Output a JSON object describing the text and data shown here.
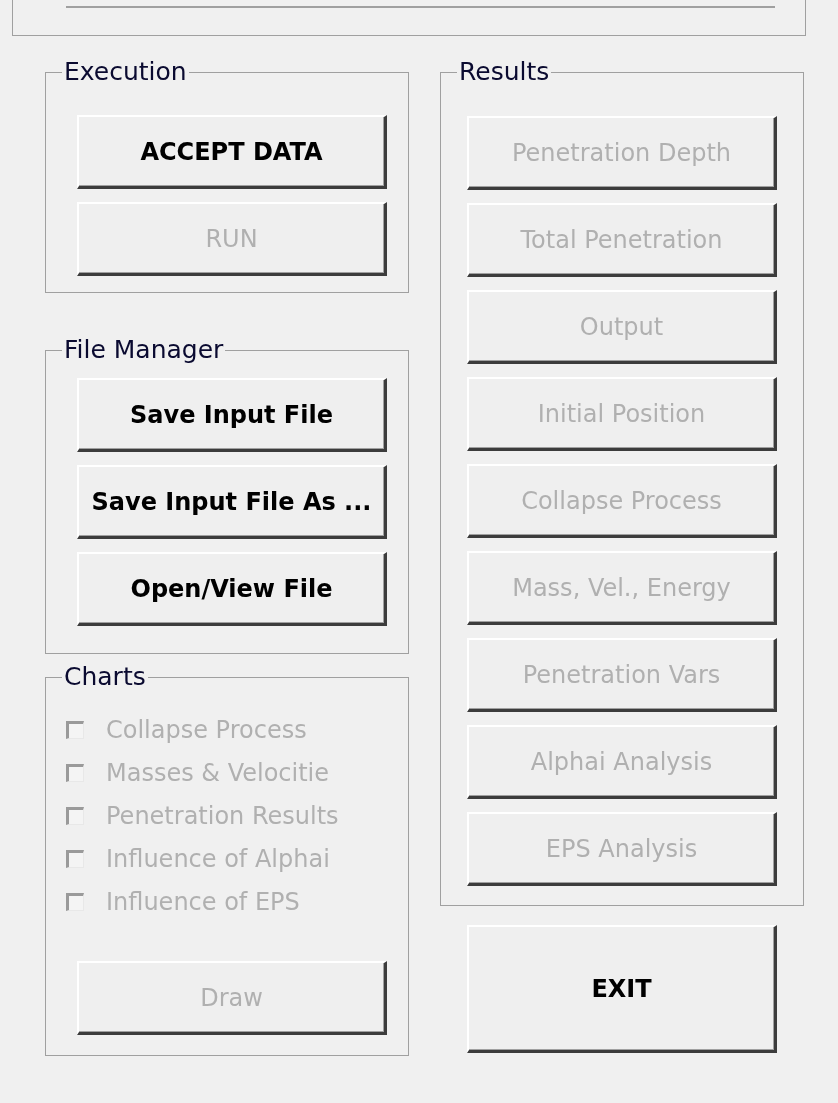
{
  "execution": {
    "title": "Execution",
    "buttons": [
      {
        "label": "ACCEPT DATA",
        "disabled": false
      },
      {
        "label": "RUN",
        "disabled": true
      }
    ]
  },
  "file_manager": {
    "title": "File Manager",
    "buttons": [
      {
        "label": "Save Input File",
        "disabled": false
      },
      {
        "label": "Save Input File As ...",
        "disabled": false
      },
      {
        "label": "Open/View File",
        "disabled": false
      }
    ]
  },
  "charts": {
    "title": "Charts",
    "checkboxes": [
      {
        "label": "Collapse Process",
        "checked": false,
        "disabled": true
      },
      {
        "label": "Masses & Velocitie",
        "checked": false,
        "disabled": true
      },
      {
        "label": "Penetration Results",
        "checked": false,
        "disabled": true
      },
      {
        "label": "Influence of Alphai",
        "checked": false,
        "disabled": true
      },
      {
        "label": "Influence of EPS",
        "checked": false,
        "disabled": true
      }
    ],
    "draw_button": {
      "label": "Draw",
      "disabled": true
    }
  },
  "results": {
    "title": "Results",
    "buttons": [
      {
        "label": "Penetration Depth",
        "disabled": true
      },
      {
        "label": "Total Penetration",
        "disabled": true
      },
      {
        "label": "Output",
        "disabled": true
      },
      {
        "label": "Initial Position",
        "disabled": true
      },
      {
        "label": "Collapse Process",
        "disabled": true
      },
      {
        "label": "Mass, Vel., Energy",
        "disabled": true
      },
      {
        "label": "Penetration Vars",
        "disabled": true
      },
      {
        "label": "Alphai Analysis",
        "disabled": true
      },
      {
        "label": "EPS Analysis",
        "disabled": true
      }
    ]
  },
  "exit_button": {
    "label": "EXIT",
    "disabled": false
  }
}
